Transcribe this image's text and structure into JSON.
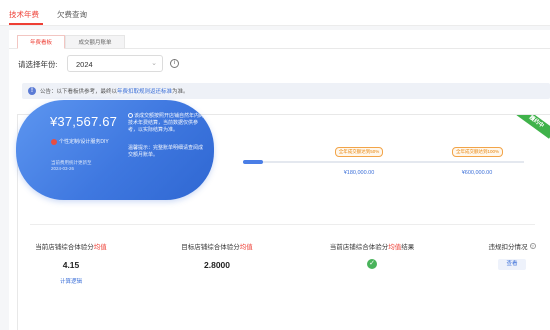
{
  "top_tabs": [
    {
      "label": "技术年费",
      "active": true
    },
    {
      "label": "欠费查询",
      "active": false
    }
  ],
  "sub_tabs": [
    {
      "label": "年费看板",
      "active": true
    },
    {
      "label": "成交额月账单",
      "active": false
    }
  ],
  "filter": {
    "year_label": "请选择年份:",
    "year_value": "2024",
    "info_icon": "info-circle-icon"
  },
  "notice": {
    "text": "公告：以下看板供参考，最终以",
    "link": "年费扣取规则返还标准",
    "suffix": "为准。"
  },
  "corner_badge": "履约中",
  "summary": {
    "amount": "¥37,567.67",
    "note": "个性定制/设计服务DIY",
    "subnote": "",
    "footer_line1": "当前费用统计更新至",
    "footer_line2": "2024-03-26",
    "desc1": "该成交额按照开店铺自然年内的技术年费结算，当前数据仅供参考，以实际结算为准。",
    "desc2": "温馨提示：完整账单明细请查阅成交额月账单。"
  },
  "progress": {
    "fraction": 0.07
  },
  "tiers": [
    {
      "tag": "全年成交额达到50%",
      "amount": "¥180,000.00"
    },
    {
      "tag": "全年成交额达到100%",
      "amount": "¥600,000.00"
    }
  ],
  "metrics": [
    {
      "label": "当前店铺综合体验分",
      "highlight": "均值",
      "value": "4.15",
      "link": "计算逻辑"
    },
    {
      "label": "目标店铺综合体验分",
      "highlight": "均值",
      "value": "2.8000"
    },
    {
      "label": "当前店铺综合体验分",
      "highlight": "均值",
      "suffix": "结果",
      "status_icon": "check-circle-icon"
    },
    {
      "label": "违规扣分情况",
      "button": "查看",
      "help_icon": "question-circle-icon"
    }
  ],
  "colors": {
    "accent_red": "#ee3f35",
    "link_blue": "#3b6fd8",
    "pill_blue": "#3f78e0",
    "success_green": "#49b35b",
    "tier_orange": "#e8850c"
  }
}
